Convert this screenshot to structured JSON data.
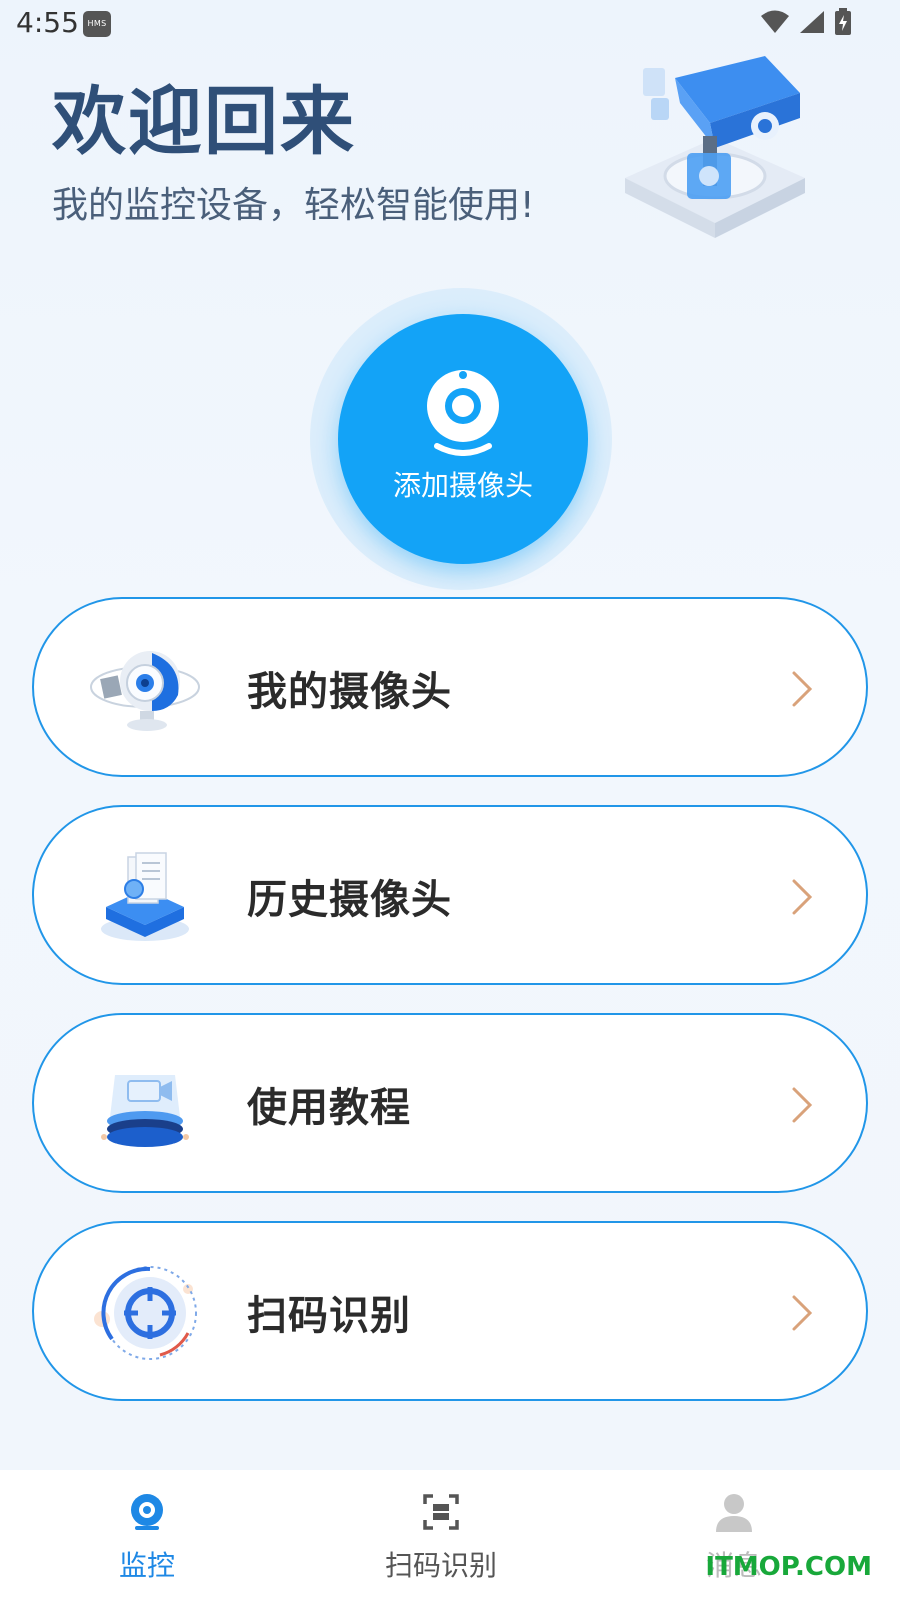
{
  "status_bar": {
    "time": "4:55",
    "badge": "HMS"
  },
  "header": {
    "title": "欢迎回来",
    "subtitle": "我的监控设备，轻松智能使用!"
  },
  "add_camera": {
    "label": "添加摄像头"
  },
  "menu": [
    {
      "label": "我的摄像头",
      "icon": "camera-icon"
    },
    {
      "label": "历史摄像头",
      "icon": "history-files-icon"
    },
    {
      "label": "使用教程",
      "icon": "tutorial-icon"
    },
    {
      "label": "扫码识别",
      "icon": "scan-target-icon"
    }
  ],
  "bottom_nav": [
    {
      "label": "监控",
      "icon": "monitor-icon",
      "active": true
    },
    {
      "label": "扫码识别",
      "icon": "scan-icon",
      "active": false
    },
    {
      "label": "消息",
      "icon": "user-icon",
      "active": false
    }
  ],
  "watermark": "ITMOP.COM",
  "colors": {
    "primary": "#13a3f7",
    "border": "#2196e8",
    "title": "#2f4f78",
    "chevron": "#d9a27a"
  }
}
